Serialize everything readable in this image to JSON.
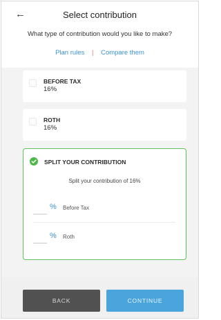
{
  "header": {
    "back_icon": "←",
    "title": "Select contribution",
    "question": "What type of contribution would you like to make?",
    "links": {
      "plan_rules": "Plan rules",
      "separator": "|",
      "compare": "Compare them"
    }
  },
  "options": [
    {
      "name": "BEFORE TAX",
      "value": "16%",
      "selected": false
    },
    {
      "name": "ROTH",
      "value": "16%",
      "selected": false
    }
  ],
  "split": {
    "title": "SPLIT YOUR CONTRIBUTION",
    "selected": true,
    "subtitle": "Split your contribution of 16%",
    "rows": [
      {
        "symbol": "%",
        "label": "Before Tax",
        "value": ""
      },
      {
        "symbol": "%",
        "label": "Roth",
        "value": ""
      }
    ]
  },
  "footer": {
    "back_label": "BACK",
    "continue_label": "CONTINUE"
  },
  "colors": {
    "accent_blue": "#3a93d6",
    "selected_green": "#4db848",
    "back_button": "#515151",
    "continue_button": "#4aa5dd"
  }
}
